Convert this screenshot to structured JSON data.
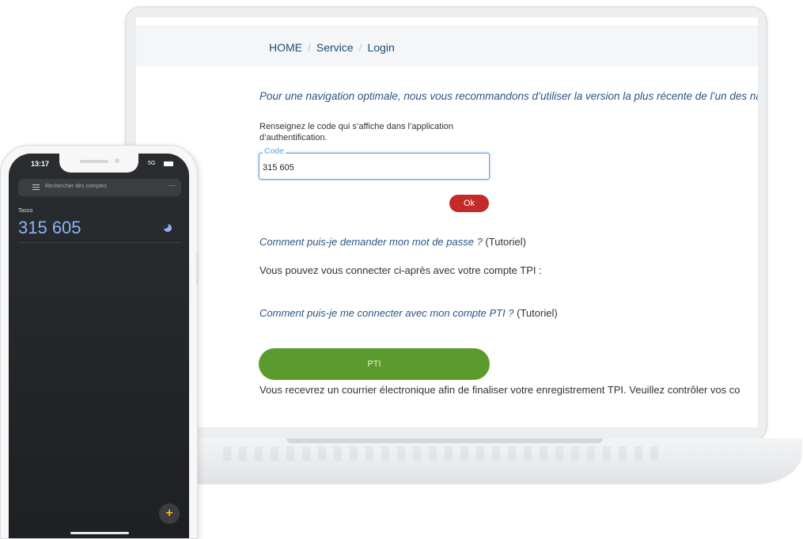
{
  "laptop": {
    "breadcrumb": [
      "HOME",
      "Service",
      "Login"
    ],
    "breadcrumb_separator": "/",
    "notice": "Pour une navigation optimale, nous vous recommandons d’utiliser la version la plus récente de l’un des nav",
    "instruction_line1": "Renseignez le code qui s’affiche dans l’application",
    "instruction_line2": "d’authentification.",
    "code_field": {
      "label": "Code",
      "value": "315 605"
    },
    "ok_label": "Ok",
    "password_link": "Comment puis-je demander mon mot de passe ?",
    "password_tutorial": " (Tutoriel)",
    "tpi_text": "Vous pouvez vous connecter ci-après avec votre compte TPI :",
    "pti_link": "Comment puis-je me connecter avec mon compte PTI ?",
    "pti_tutorial": " (Tutoriel)",
    "pti_button_label": "PTI",
    "footer_text": "Vous recevrez un courrier électronique afin de finaliser votre enregistrement TPI. Veuillez contrôler vos co"
  },
  "phone": {
    "clock": "13:17",
    "network": "5G",
    "search_placeholder": "Rechercher des comptes",
    "more_glyph": "···",
    "account_name": "Tocco",
    "otp_code": "315 605",
    "fab_glyph": "+"
  },
  "colors": {
    "link_blue": "#2b5484",
    "ok_red": "#c32b2b",
    "pti_green": "#5b9a2c",
    "otp_blue": "#8ab4f8",
    "phone_bg": "#2a2d30"
  },
  "icons": [
    "menu-icon",
    "more-options-icon",
    "timer-icon",
    "add-icon",
    "battery-icon"
  ]
}
